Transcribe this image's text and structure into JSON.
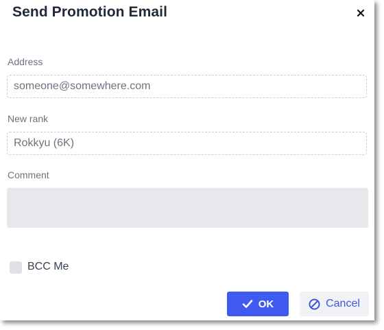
{
  "dialog": {
    "title": "Send Promotion Email",
    "close_icon": "close-icon"
  },
  "form": {
    "address_label": "Address",
    "address_value": "someone@somewhere.com",
    "rank_label": "New rank",
    "rank_value": "Rokkyu (6K)",
    "comment_label": "Comment",
    "comment_value": "",
    "bcc_label": "BCC Me",
    "bcc_checked": false
  },
  "buttons": {
    "ok_label": "OK",
    "ok_icon": "check-icon",
    "cancel_label": "Cancel",
    "cancel_icon": "cancel-icon"
  },
  "colors": {
    "primary": "#3f5bef",
    "cancel_text": "#3f55d9",
    "title": "#1f2a37"
  }
}
